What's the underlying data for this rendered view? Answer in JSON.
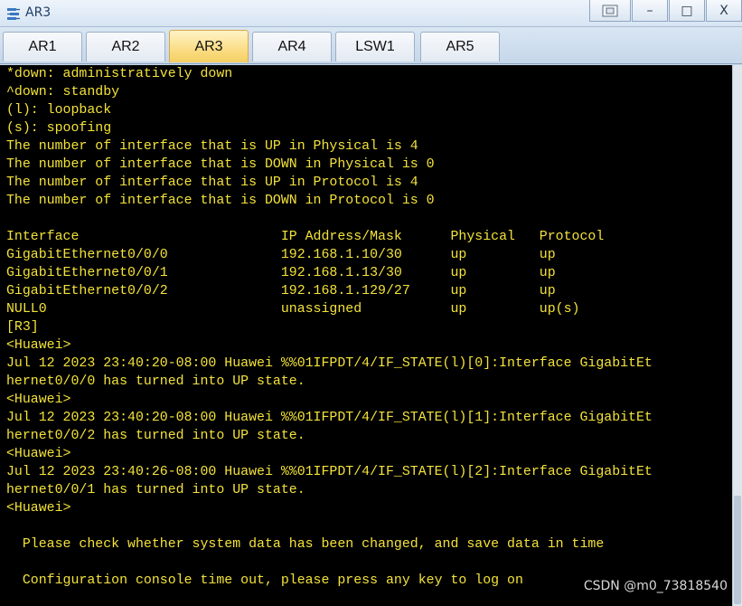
{
  "window": {
    "title": "AR3",
    "icon": "router-icon",
    "restore_label": "",
    "minimize_label": "–",
    "maximize_label": "□",
    "close_label": "X"
  },
  "tabs": [
    {
      "label": "AR1",
      "active": false
    },
    {
      "label": "AR2",
      "active": false
    },
    {
      "label": "AR3",
      "active": true
    },
    {
      "label": "AR4",
      "active": false
    },
    {
      "label": "LSW1",
      "active": false
    },
    {
      "label": "AR5",
      "active": false
    }
  ],
  "terminal": {
    "text_color": "#f3e23a",
    "background": "#000000",
    "lines": [
      "*down: administratively down",
      "^down: standby",
      "(l): loopback",
      "(s): spoofing",
      "The number of interface that is UP in Physical is 4",
      "The number of interface that is DOWN in Physical is 0",
      "The number of interface that is UP in Protocol is 4",
      "The number of interface that is DOWN in Protocol is 0",
      "",
      "Interface                         IP Address/Mask      Physical   Protocol",
      "GigabitEthernet0/0/0              192.168.1.10/30      up         up",
      "GigabitEthernet0/0/1              192.168.1.13/30      up         up",
      "GigabitEthernet0/0/2              192.168.1.129/27     up         up",
      "NULL0                             unassigned           up         up(s)",
      "[R3]",
      "<Huawei>",
      "Jul 12 2023 23:40:20-08:00 Huawei %%01IFPDT/4/IF_STATE(l)[0]:Interface GigabitEt",
      "hernet0/0/0 has turned into UP state.",
      "<Huawei>",
      "Jul 12 2023 23:40:20-08:00 Huawei %%01IFPDT/4/IF_STATE(l)[1]:Interface GigabitEt",
      "hernet0/0/2 has turned into UP state.",
      "<Huawei>",
      "Jul 12 2023 23:40:26-08:00 Huawei %%01IFPDT/4/IF_STATE(l)[2]:Interface GigabitEt",
      "hernet0/0/1 has turned into UP state.",
      "<Huawei>",
      "",
      "  Please check whether system data has been changed, and save data in time",
      "",
      "  Configuration console time out, please press any key to log on"
    ]
  },
  "watermark": "CSDN @m0_73818540"
}
